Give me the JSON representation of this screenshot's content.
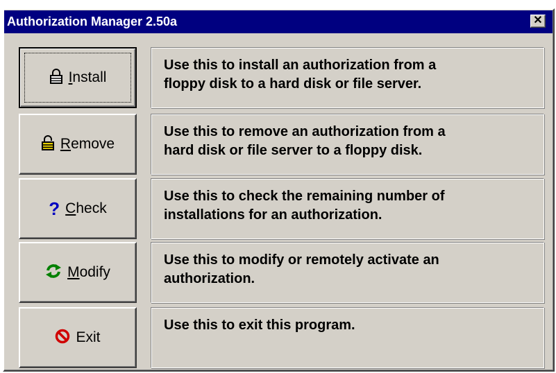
{
  "window": {
    "title": "Authorization Manager 2.50a",
    "close_label": "✕"
  },
  "rows": [
    {
      "button": {
        "mnemonic": "I",
        "rest": "nstall",
        "icon": "lock-icon"
      },
      "description": "Use this  to install an authorization from a\nfloppy disk to a hard disk or file server."
    },
    {
      "button": {
        "mnemonic": "R",
        "rest": "emove",
        "icon": "unlock-icon"
      },
      "description": "Use this to remove an authorization from a\nhard disk or file server to a floppy disk."
    },
    {
      "button": {
        "mnemonic": "C",
        "rest": "heck",
        "icon": "question-icon"
      },
      "description": "Use this to check the remaining number of\ninstallations for an authorization."
    },
    {
      "button": {
        "mnemonic": "M",
        "rest": "odify",
        "icon": "refresh-icon"
      },
      "description": "Use this to modify or remotely activate an\nauthorization."
    },
    {
      "button": {
        "mnemonic": "",
        "rest": "Exit",
        "icon": "no-entry-icon"
      },
      "description": "Use this to exit this program."
    }
  ],
  "colors": {
    "titlebar": "#000080",
    "face": "#d4d0c8",
    "question_icon": "#0000c0",
    "refresh_icon": "#008000",
    "exit_icon": "#d00000"
  }
}
